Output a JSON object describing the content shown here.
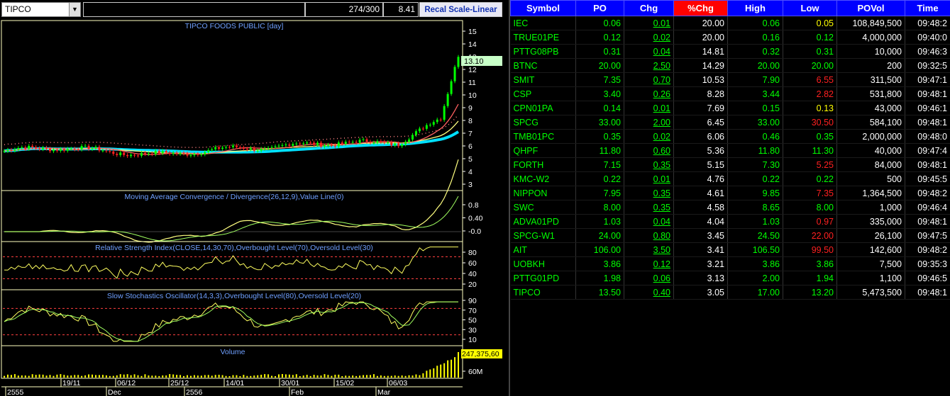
{
  "toolbar": {
    "symbol": "TIPCO",
    "count": "274/300",
    "value": "8.41",
    "recal_label": "Recal Scale-Linear"
  },
  "charts": {
    "price": {
      "title": "TIPCO FOODS PUBLIC [day]",
      "axis_ticks": [
        "15",
        "14",
        "13",
        "12",
        "11",
        "10",
        "9",
        "8",
        "7",
        "6",
        "5",
        "4",
        "3"
      ],
      "last_label": "13.10"
    },
    "macd": {
      "title": "Moving Average Convergence / Divergence(26,12,9),Value Line(0)",
      "axis_ticks": [
        "0.8",
        "0.40",
        "-0.0"
      ]
    },
    "rsi": {
      "title": "Relative Strength Index(CLOSE,14,30,70),Overbought Level(70),Oversold Level(30)",
      "axis_ticks": [
        "80",
        "60",
        "40",
        "20"
      ]
    },
    "stoch": {
      "title": "Slow Stochastics Oscillator(14,3,3),Overbought Level(80),Oversold Level(20)",
      "axis_ticks": [
        "90",
        "70",
        "50",
        "30",
        "10"
      ]
    },
    "volume": {
      "title": "Volume",
      "axis_ticks": [
        "60M"
      ],
      "last_label": "247,375,60"
    },
    "date_labels": [
      "19/11",
      "06/12",
      "25/12",
      "14/01",
      "30/01",
      "15/02",
      "06/03"
    ],
    "period_labels": [
      "2555",
      "Dec",
      "2556",
      "Feb",
      "Mar"
    ]
  },
  "colors": {
    "header_blue": "#0000ff",
    "header_sorted": "#ff0000",
    "up_green": "#00ff00",
    "down_red": "#ff2020",
    "unchanged_yellow": "#ffff00",
    "chart_label": "#6fa0ff",
    "guide_red": "#ff4040"
  },
  "table": {
    "columns": [
      "Symbol",
      "PO",
      "Chg",
      "%Chg",
      "High",
      "Low",
      "POVol",
      "Time"
    ],
    "sorted_column": "%Chg",
    "rows": [
      {
        "symbol": "IEC",
        "po": "0.06",
        "chg": "0.01",
        "pct": "20.00",
        "high": "0.06",
        "low": "0.05",
        "low_color": "y",
        "povol": "108,849,500",
        "time": "09:48:2"
      },
      {
        "symbol": "TRUE01PE",
        "po": "0.12",
        "chg": "0.02",
        "pct": "20.00",
        "high": "0.16",
        "low": "0.12",
        "low_color": "g",
        "povol": "4,000,000",
        "time": "09:40:0"
      },
      {
        "symbol": "PTTG08PB",
        "po": "0.31",
        "chg": "0.04",
        "pct": "14.81",
        "high": "0.32",
        "low": "0.31",
        "low_color": "g",
        "povol": "10,000",
        "time": "09:46:3"
      },
      {
        "symbol": "BTNC",
        "po": "20.00",
        "chg": "2.50",
        "pct": "14.29",
        "high": "20.00",
        "low": "20.00",
        "low_color": "g",
        "povol": "200",
        "time": "09:32:5"
      },
      {
        "symbol": "SMIT",
        "po": "7.35",
        "chg": "0.70",
        "pct": "10.53",
        "high": "7.90",
        "low": "6.55",
        "low_color": "r",
        "povol": "311,500",
        "time": "09:47:1"
      },
      {
        "symbol": "CSP",
        "po": "3.40",
        "chg": "0.26",
        "pct": "8.28",
        "high": "3.44",
        "low": "2.82",
        "low_color": "r",
        "povol": "531,800",
        "time": "09:48:1"
      },
      {
        "symbol": "CPN01PA",
        "po": "0.14",
        "chg": "0.01",
        "pct": "7.69",
        "high": "0.15",
        "low": "0.13",
        "low_color": "y",
        "povol": "43,000",
        "time": "09:46:1"
      },
      {
        "symbol": "SPCG",
        "po": "33.00",
        "chg": "2.00",
        "pct": "6.45",
        "high": "33.00",
        "low": "30.50",
        "low_color": "r",
        "povol": "584,100",
        "time": "09:48:1"
      },
      {
        "symbol": "TMB01PC",
        "po": "0.35",
        "chg": "0.02",
        "pct": "6.06",
        "high": "0.46",
        "low": "0.35",
        "low_color": "g",
        "povol": "2,000,000",
        "time": "09:48:0"
      },
      {
        "symbol": "QHPF",
        "po": "11.80",
        "chg": "0.60",
        "pct": "5.36",
        "high": "11.80",
        "low": "11.30",
        "low_color": "g",
        "povol": "40,000",
        "time": "09:47:4"
      },
      {
        "symbol": "FORTH",
        "po": "7.15",
        "chg": "0.35",
        "pct": "5.15",
        "high": "7.30",
        "low": "5.25",
        "low_color": "r",
        "povol": "84,000",
        "time": "09:48:1"
      },
      {
        "symbol": "KMC-W2",
        "po": "0.22",
        "chg": "0.01",
        "pct": "4.76",
        "high": "0.22",
        "low": "0.22",
        "low_color": "g",
        "povol": "500",
        "time": "09:45:5"
      },
      {
        "symbol": "NIPPON",
        "po": "7.95",
        "chg": "0.35",
        "pct": "4.61",
        "high": "9.85",
        "low": "7.35",
        "low_color": "r",
        "povol": "1,364,500",
        "time": "09:48:2"
      },
      {
        "symbol": "SWC",
        "po": "8.00",
        "chg": "0.35",
        "pct": "4.58",
        "high": "8.65",
        "low": "8.00",
        "low_color": "g",
        "povol": "1,000",
        "time": "09:46:4"
      },
      {
        "symbol": "ADVA01PD",
        "po": "1.03",
        "chg": "0.04",
        "pct": "4.04",
        "high": "1.03",
        "low": "0.97",
        "low_color": "r",
        "povol": "335,000",
        "time": "09:48:1"
      },
      {
        "symbol": "SPCG-W1",
        "po": "24.00",
        "chg": "0.80",
        "pct": "3.45",
        "high": "24.50",
        "low": "22.00",
        "low_color": "r",
        "povol": "26,100",
        "time": "09:47:5"
      },
      {
        "symbol": "AIT",
        "po": "106.00",
        "chg": "3.50",
        "pct": "3.41",
        "high": "106.50",
        "low": "99.50",
        "low_color": "r",
        "povol": "142,600",
        "time": "09:48:2"
      },
      {
        "symbol": "UOBKH",
        "po": "3.86",
        "chg": "0.12",
        "pct": "3.21",
        "high": "3.86",
        "low": "3.86",
        "low_color": "g",
        "povol": "7,500",
        "time": "09:35:3"
      },
      {
        "symbol": "PTTG01PD",
        "po": "1.98",
        "chg": "0.06",
        "pct": "3.13",
        "high": "2.00",
        "low": "1.94",
        "low_color": "g",
        "povol": "1,100",
        "time": "09:46:5"
      },
      {
        "symbol": "TIPCO",
        "po": "13.50",
        "chg": "0.40",
        "pct": "3.05",
        "high": "17.00",
        "low": "13.20",
        "low_color": "g",
        "povol": "5,473,500",
        "time": "09:48:1"
      }
    ]
  }
}
